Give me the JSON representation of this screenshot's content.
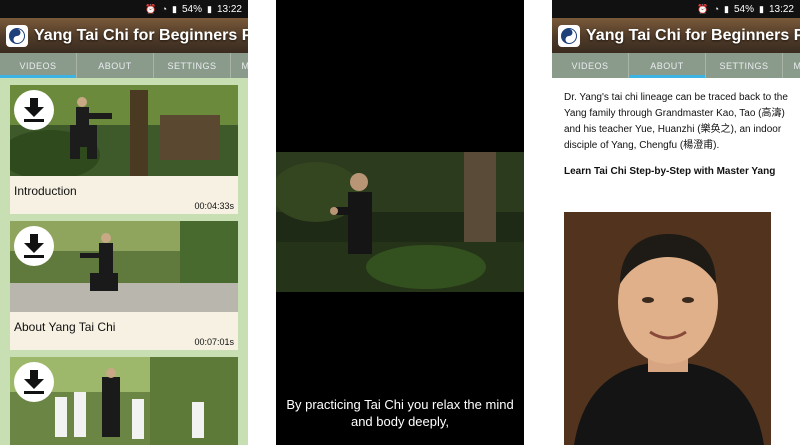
{
  "status": {
    "signal": "54%",
    "time": "13:22"
  },
  "app": {
    "title": "Yang Tai Chi for Beginners P..."
  },
  "tabs": [
    "VIDEOS",
    "ABOUT",
    "SETTINGS",
    "M"
  ],
  "videos": [
    {
      "title": "Introduction",
      "duration": "00:04:33s"
    },
    {
      "title": "About Yang Tai Chi",
      "duration": "00:07:01s"
    },
    {
      "title": "",
      "duration": ""
    }
  ],
  "player": {
    "subtitle": "By practicing Tai Chi you relax the mind and body deeply,"
  },
  "about": {
    "paragraph": "Dr. Yang's tai chi lineage can be traced back to the Yang family through Grandmaster Kao, Tao (高濤) and his teacher Yue, Huanzhi (樂奂之), an indoor disciple of Yang, Chengfu (楊澄甫).",
    "heading": "Learn Tai Chi Step-by-Step with Master Yang"
  },
  "colors": {
    "accent": "#3db3e3",
    "list_bg": "#c7dfb2",
    "tabbar": "#8b9b8b"
  },
  "icons": [
    "battery-icon",
    "wifi-icon",
    "alarm-icon",
    "download-icon",
    "logo-icon"
  ]
}
